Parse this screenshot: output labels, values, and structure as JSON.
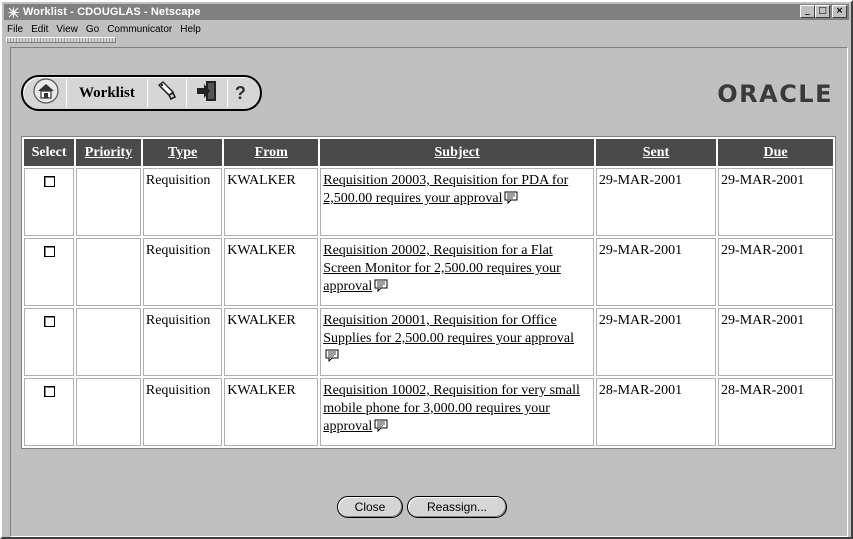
{
  "window": {
    "title": "Worklist - CDOUGLAS - Netscape",
    "controls": {
      "minimize": "_",
      "maximize": "□",
      "close": "×"
    }
  },
  "menubar": {
    "items": [
      {
        "label": "File"
      },
      {
        "label": "Edit"
      },
      {
        "label": "View"
      },
      {
        "label": "Go"
      },
      {
        "label": "Communicator"
      },
      {
        "label": "Help"
      }
    ]
  },
  "global_buttons": {
    "home_icon": "home-icon",
    "worklist_label": "Worklist",
    "preferences_icon": "preferences-icon",
    "logout_icon": "logout-icon",
    "help_label": "?"
  },
  "brand": {
    "logo": "ORACLE"
  },
  "table": {
    "headers": {
      "select": "Select",
      "priority": "Priority",
      "type": "Type",
      "from": "From",
      "subject": "Subject",
      "sent": "Sent",
      "due": "Due"
    },
    "rows": [
      {
        "priority": "",
        "type": "Requisition",
        "from": "KWALKER",
        "subject": "Requisition 20003, Requisition for PDA for 2,500.00 requires your approval",
        "sent": "29-MAR-2001",
        "due": "29-MAR-2001"
      },
      {
        "priority": "",
        "type": "Requisition",
        "from": "KWALKER",
        "subject": "Requisition 20002, Requisition for a Flat Screen Monitor for 2,500.00 requires your approval",
        "sent": "29-MAR-2001",
        "due": "29-MAR-2001"
      },
      {
        "priority": "",
        "type": "Requisition",
        "from": "KWALKER",
        "subject": "Requisition 20001, Requisition for Office Supplies for 2,500.00 requires your approval",
        "sent": "29-MAR-2001",
        "due": "29-MAR-2001"
      },
      {
        "priority": "",
        "type": "Requisition",
        "from": "KWALKER",
        "subject": "Requisition 10002, Requisition for very small mobile phone for 3,000.00 requires your approval",
        "sent": "28-MAR-2001",
        "due": "28-MAR-2001"
      }
    ]
  },
  "actions": {
    "close_label": "Close",
    "reassign_label": "Reassign..."
  }
}
